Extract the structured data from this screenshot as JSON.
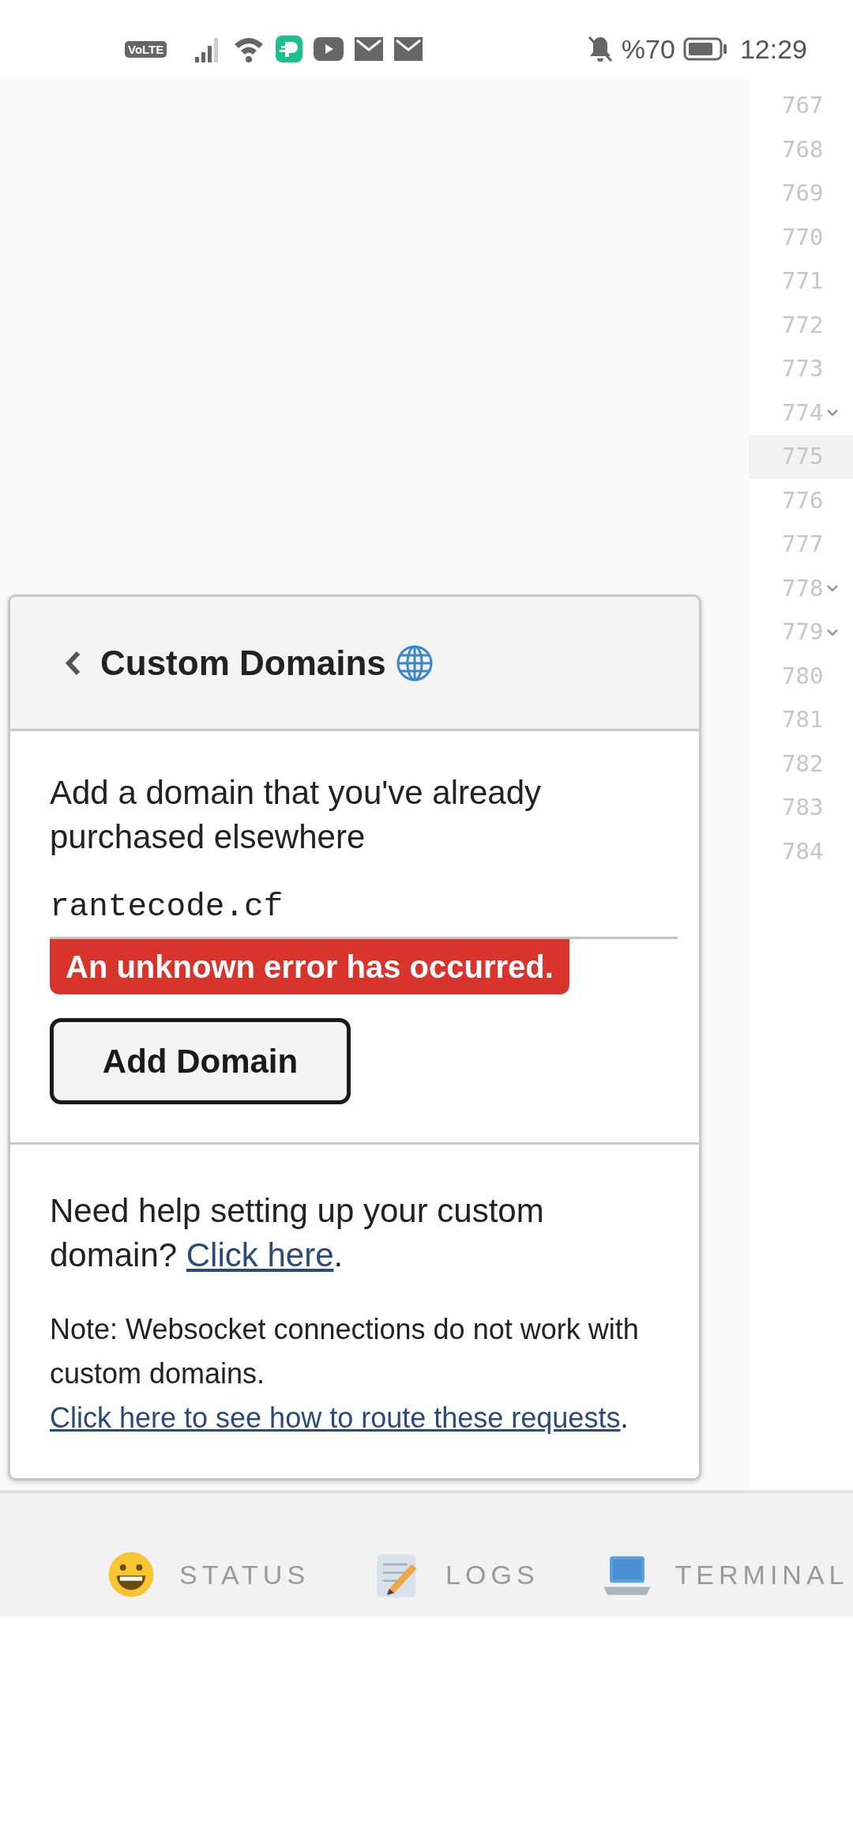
{
  "status_bar": {
    "network_badge": "VoLTE",
    "battery": "%70",
    "time": "12:29"
  },
  "editor": {
    "line_numbers": [
      {
        "number": "767",
        "foldable": false,
        "selected": false
      },
      {
        "number": "768",
        "foldable": false,
        "selected": false
      },
      {
        "number": "769",
        "foldable": false,
        "selected": false
      },
      {
        "number": "770",
        "foldable": false,
        "selected": false
      },
      {
        "number": "771",
        "foldable": false,
        "selected": false
      },
      {
        "number": "772",
        "foldable": false,
        "selected": false
      },
      {
        "number": "773",
        "foldable": false,
        "selected": false
      },
      {
        "number": "774",
        "foldable": true,
        "selected": false
      },
      {
        "number": "775",
        "foldable": false,
        "selected": true
      },
      {
        "number": "776",
        "foldable": false,
        "selected": false
      },
      {
        "number": "777",
        "foldable": false,
        "selected": false
      },
      {
        "number": "778",
        "foldable": true,
        "selected": false
      },
      {
        "number": "779",
        "foldable": true,
        "selected": false
      },
      {
        "number": "780",
        "foldable": false,
        "selected": false
      },
      {
        "number": "781",
        "foldable": false,
        "selected": false
      },
      {
        "number": "782",
        "foldable": false,
        "selected": false
      },
      {
        "number": "783",
        "foldable": false,
        "selected": false
      },
      {
        "number": "784",
        "foldable": false,
        "selected": false
      }
    ]
  },
  "dialog": {
    "title": "Custom Domains",
    "description": "Add a domain that you've already purchased elsewhere",
    "domain_input": {
      "value": "rantecode.cf"
    },
    "error": "An unknown error has occurred.",
    "add_button": "Add Domain",
    "help": {
      "text": "Need help setting up your custom domain? ",
      "link": "Click here",
      "after": "."
    },
    "note": {
      "text": "Note: Websocket connections do not work with custom domains. ",
      "link": "Click here to see how to route these requests",
      "after": "."
    }
  },
  "bottom_tabs": [
    {
      "label": "STATUS",
      "kind": "smiley"
    },
    {
      "label": "LOGS",
      "kind": "memo"
    },
    {
      "label": "TERMINAL",
      "kind": "laptop"
    }
  ]
}
